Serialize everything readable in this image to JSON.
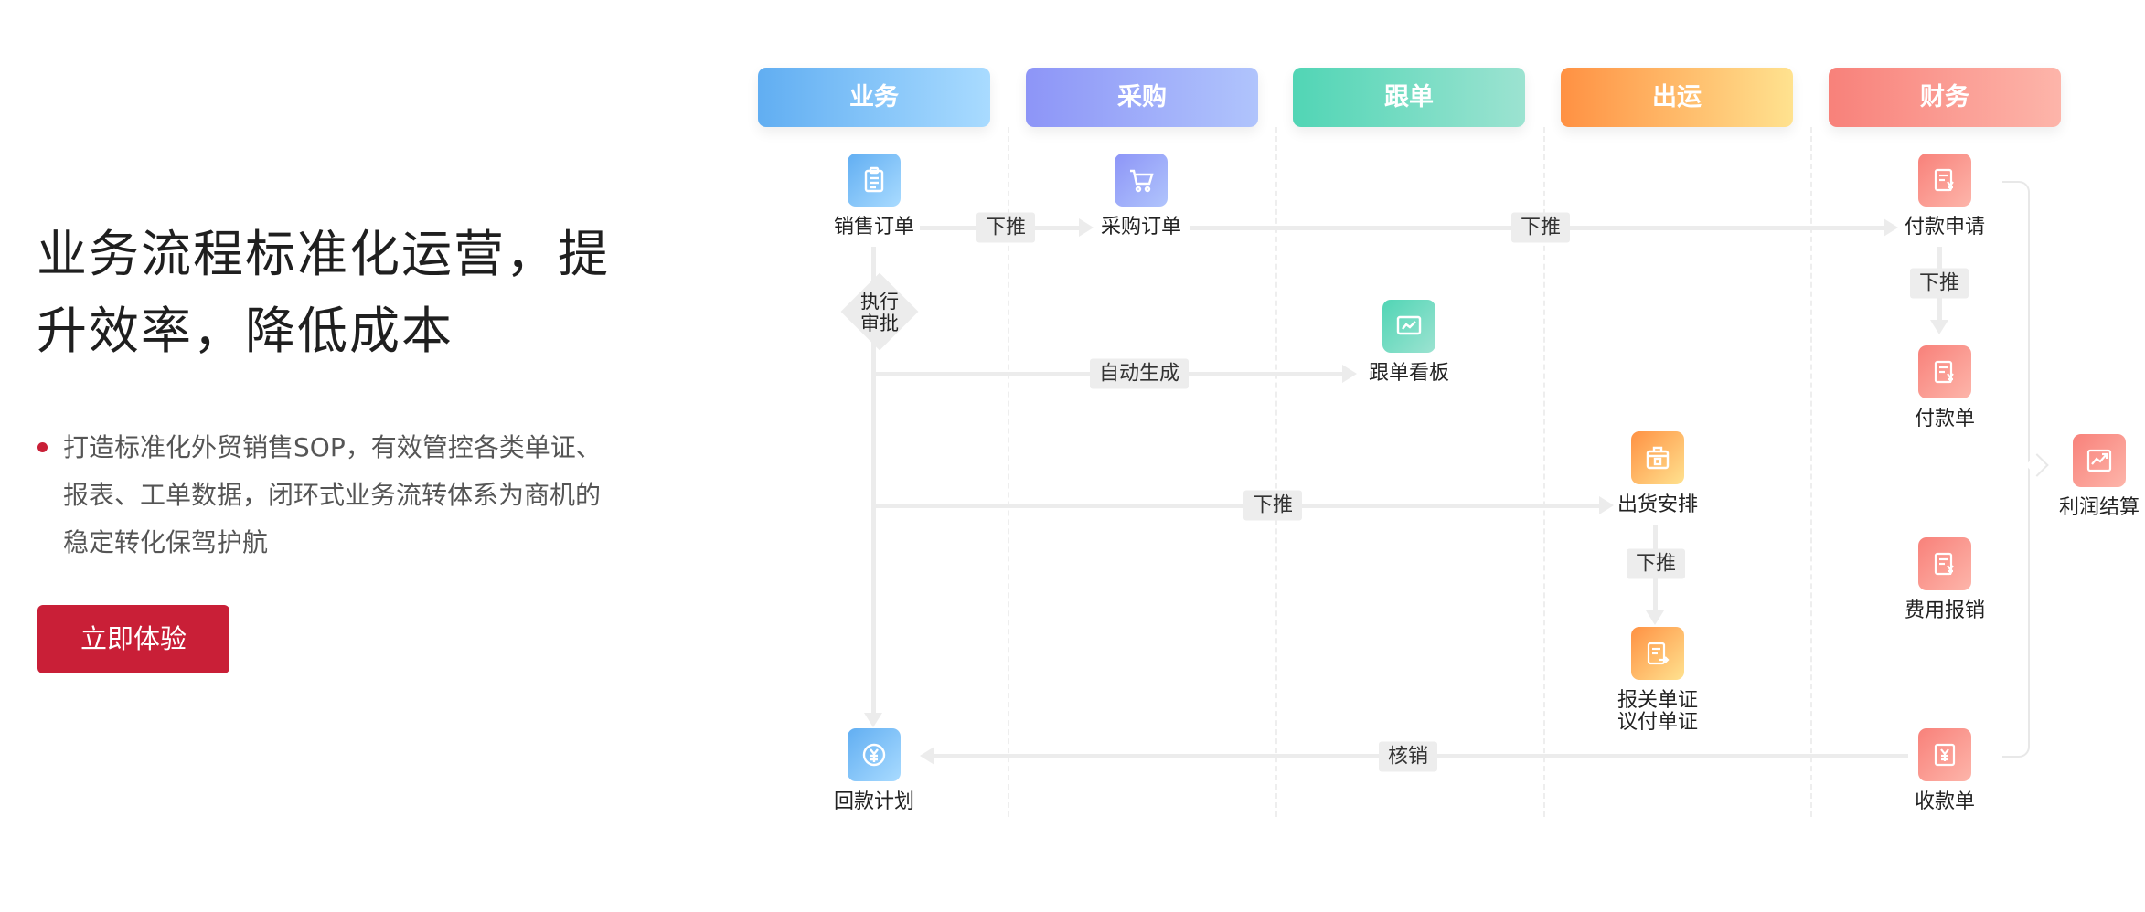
{
  "intro": {
    "headline": "业务流程标准化运营，提升效率，降低成本",
    "bullet": "打造标准化外贸销售SOP，有效管控各类单证、报表、工单数据，闭环式业务流转体系为商机的稳定转化保驾护航",
    "cta_label": "立即体验",
    "brand_color": "#c91f37"
  },
  "lanes": [
    {
      "label": "业务",
      "colors": [
        "#61aef2",
        "#a9dbff"
      ]
    },
    {
      "label": "采购",
      "colors": [
        "#8d95f7",
        "#b0c4fc"
      ]
    },
    {
      "label": "跟单",
      "colors": [
        "#51d5b5",
        "#9ce3d1"
      ]
    },
    {
      "label": "出运",
      "colors": [
        "#ff9143",
        "#ffe28f"
      ]
    },
    {
      "label": "财务",
      "colors": [
        "#f8817a",
        "#fdb5aa"
      ]
    }
  ],
  "nodes": {
    "sales_order": {
      "label": "销售订单",
      "icon": "clipboard-icon"
    },
    "purchase_order": {
      "label": "采购订单",
      "icon": "cart-icon"
    },
    "payment_request": {
      "label": "付款申请",
      "icon": "document-yen-icon"
    },
    "approval": {
      "label": "执行\n审批"
    },
    "tracking_board": {
      "label": "跟单看板",
      "icon": "chart-board-icon"
    },
    "payment_slip": {
      "label": "付款单",
      "icon": "document-yen-icon"
    },
    "shipment_plan": {
      "label": "出货安排",
      "icon": "box-icon"
    },
    "profit_settlement": {
      "label": "利润结算",
      "icon": "trend-yen-icon"
    },
    "expense_claim": {
      "label": "费用报销",
      "icon": "document-yen-icon"
    },
    "customs_docs": {
      "label": "报关单证\n议付单证",
      "icon": "document-arrow-icon"
    },
    "collection_plan": {
      "label": "回款计划",
      "icon": "coin-yen-icon"
    },
    "receipt": {
      "label": "收款单",
      "icon": "receipt-yen-icon"
    }
  },
  "edges": {
    "push_1": "下推",
    "push_2": "下推",
    "push_3": "下推",
    "auto_generate": "自动生成",
    "push_4": "下推",
    "push_5": "下推",
    "write_off": "核销"
  }
}
